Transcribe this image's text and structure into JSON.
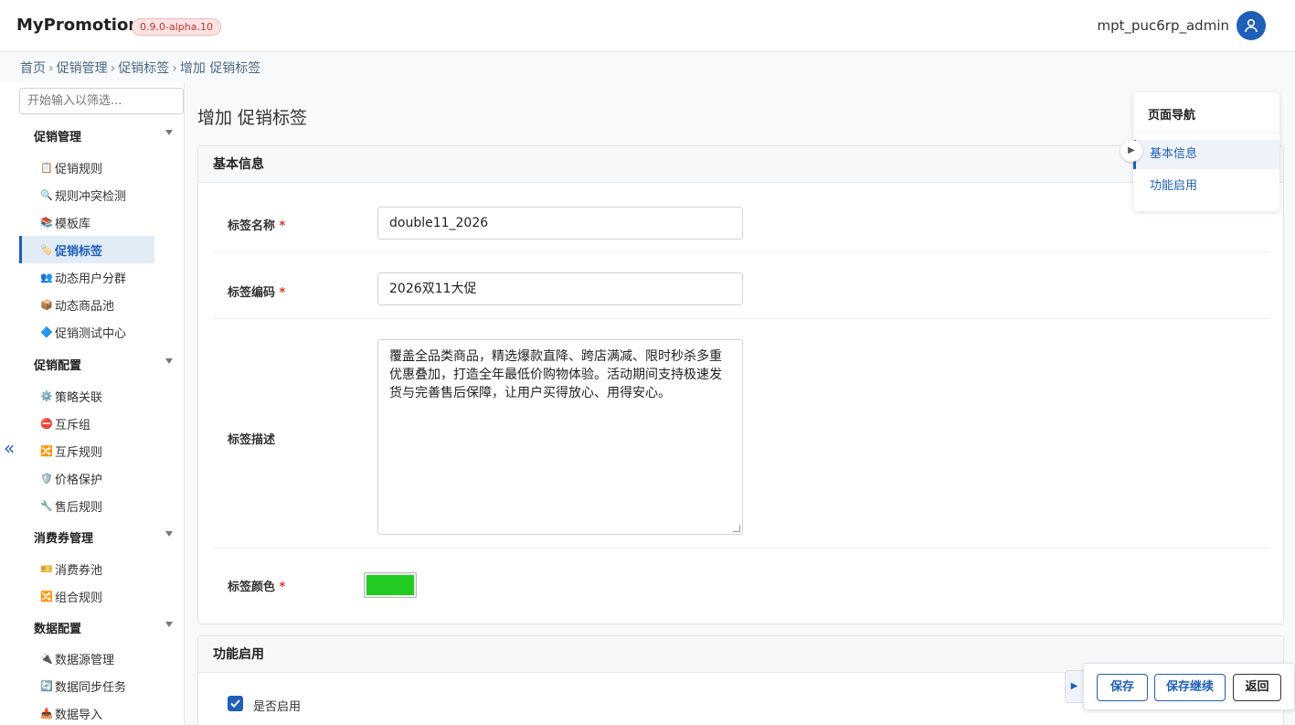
{
  "header": {
    "brand": "MyPromotion",
    "version": "0.9.0-alpha.10",
    "username": "mpt_puc6rp_admin",
    "avatar_icon": "user-icon"
  },
  "breadcrumb": [
    "首页",
    "促销管理",
    "促销标签",
    "增加 促销标签"
  ],
  "sidebar": {
    "filter_placeholder": "开始输入以筛选...",
    "groups": [
      {
        "title": "促销管理",
        "items": [
          {
            "icon": "📋",
            "label": "促销规则"
          },
          {
            "icon": "🔍",
            "label": "规则冲突检测"
          },
          {
            "icon": "📚",
            "label": "模板库"
          },
          {
            "icon": "🏷️",
            "label": "促销标签",
            "active": true
          },
          {
            "icon": "👥",
            "label": "动态用户分群"
          },
          {
            "icon": "📦",
            "label": "动态商品池"
          },
          {
            "icon": "🔷",
            "label": "促销测试中心"
          }
        ]
      },
      {
        "title": "促销配置",
        "items": [
          {
            "icon": "⚙️",
            "label": "策略关联"
          },
          {
            "icon": "⛔",
            "label": "互斥组"
          },
          {
            "icon": "🔀",
            "label": "互斥规则"
          },
          {
            "icon": "🛡️",
            "label": "价格保护"
          },
          {
            "icon": "🔧",
            "label": "售后规则"
          }
        ]
      },
      {
        "title": "消费券管理",
        "items": [
          {
            "icon": "🎫",
            "label": "消费券池"
          },
          {
            "icon": "🔀",
            "label": "组合规则"
          }
        ]
      },
      {
        "title": "数据配置",
        "items": [
          {
            "icon": "🔌",
            "label": "数据源管理"
          },
          {
            "icon": "🔄",
            "label": "数据同步任务"
          },
          {
            "icon": "📥",
            "label": "数据导入"
          }
        ]
      }
    ],
    "collapse_glyph": "«"
  },
  "main": {
    "title": "增加 促销标签",
    "basic_section": "基本信息",
    "fields": {
      "name_label": "标签名称",
      "name_value": "double11_2026",
      "code_label": "标签编码",
      "code_value": "2026双11大促",
      "desc_label": "标签描述",
      "desc_value": "覆盖全品类商品，精选爆款直降、跨店满减、限时秒杀多重优惠叠加，打造全年最低价购物体验。活动期间支持极速发货与完善售后保障，让用户买得放心、用得安心。",
      "color_label": "标签颜色",
      "color_value": "#22cc22",
      "required_mark": "*"
    },
    "enable_section": "功能启用",
    "enable_label": "是否启用",
    "enable_checked": true
  },
  "right_nav": {
    "title": "页面导航",
    "items": [
      {
        "label": "基本信息",
        "active": true
      },
      {
        "label": "功能启用",
        "active": false
      }
    ]
  },
  "actions": {
    "save": "保存",
    "save_continue": "保存继续",
    "back": "返回"
  }
}
